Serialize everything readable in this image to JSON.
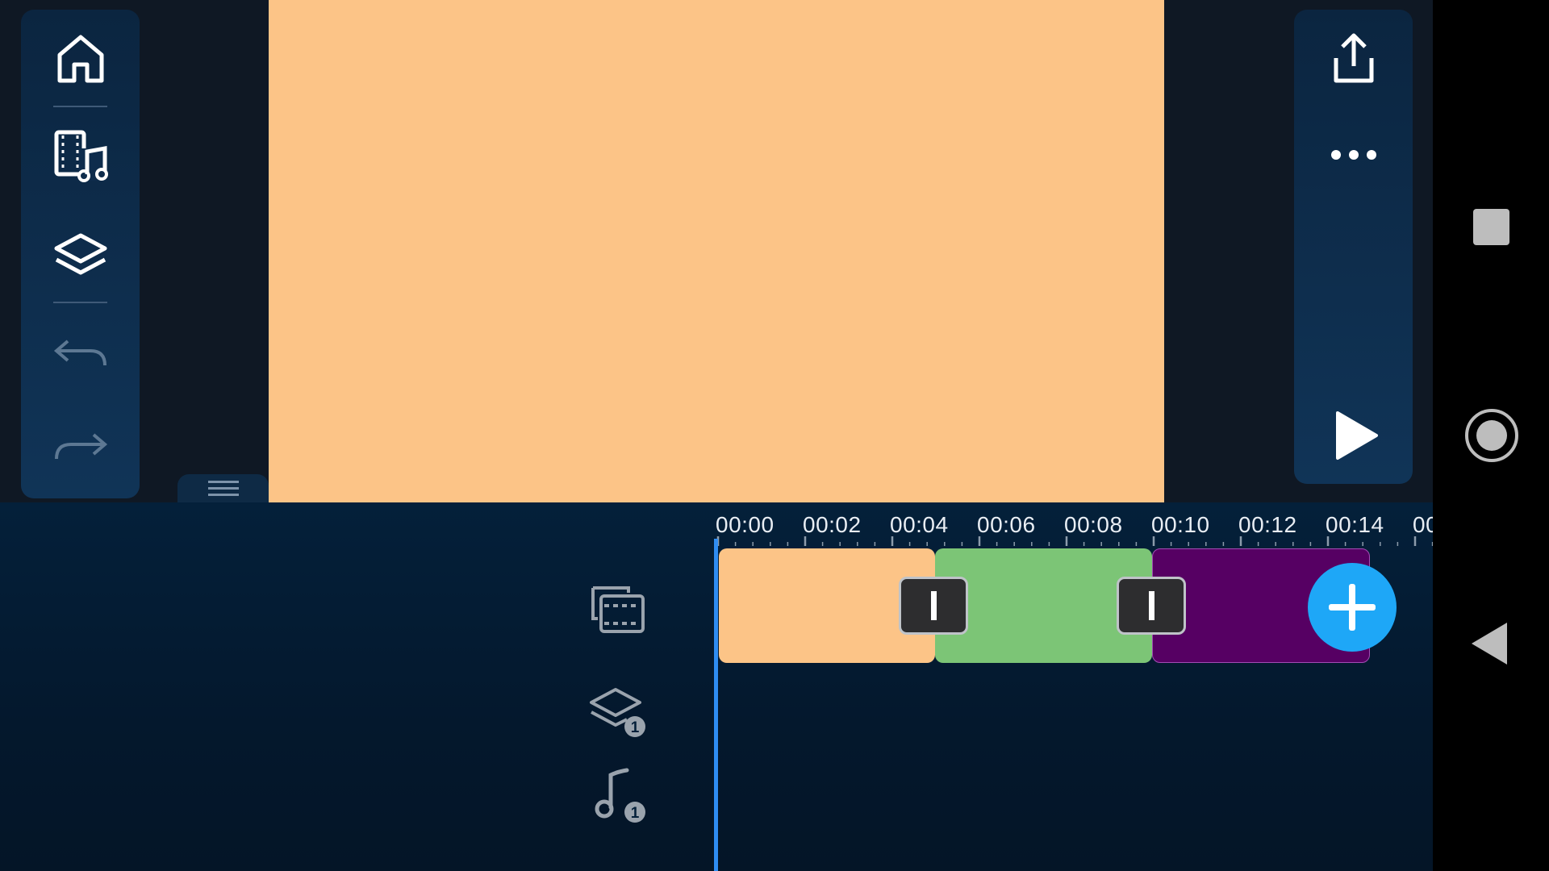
{
  "colors": {
    "background": "#0f1824",
    "preview_fill": "#fcc487",
    "panel": "#0e2c4c",
    "playhead": "#2f8df2",
    "add_button": "#1ea7f7",
    "clip_1": "#fcc487",
    "clip_2": "#7cc576",
    "clip_3": "#560063"
  },
  "left_toolbar": {
    "items": [
      {
        "name": "home",
        "icon": "home-icon"
      },
      {
        "name": "media",
        "icon": "media-music-icon"
      },
      {
        "name": "layers",
        "icon": "layers-icon"
      },
      {
        "name": "undo",
        "icon": "undo-icon",
        "enabled": false
      },
      {
        "name": "redo",
        "icon": "redo-icon",
        "enabled": false
      }
    ]
  },
  "right_toolbar": {
    "items": [
      {
        "name": "export",
        "icon": "export-icon"
      },
      {
        "name": "more",
        "icon": "more-icon"
      },
      {
        "name": "play",
        "icon": "play-icon"
      }
    ]
  },
  "timeline": {
    "ruler_labels": [
      "00:00",
      "00:02",
      "00:04",
      "00:06",
      "00:08",
      "00:10",
      "00:12",
      "00:14",
      "00"
    ],
    "tracks": [
      {
        "name": "video-track",
        "icon": "video-track-icon"
      },
      {
        "name": "layer-track",
        "icon": "layer-track-icon",
        "badge": "1"
      },
      {
        "name": "audio-track",
        "icon": "audio-track-icon",
        "badge": "1"
      }
    ],
    "clips": [
      {
        "name": "clip-1",
        "color": "#fcc487"
      },
      {
        "name": "clip-2",
        "color": "#7cc576"
      },
      {
        "name": "clip-3",
        "color": "#560063"
      }
    ],
    "transitions": 2
  },
  "nav_bar": {
    "buttons": [
      "recents-icon",
      "home-nav-icon",
      "back-icon"
    ]
  }
}
